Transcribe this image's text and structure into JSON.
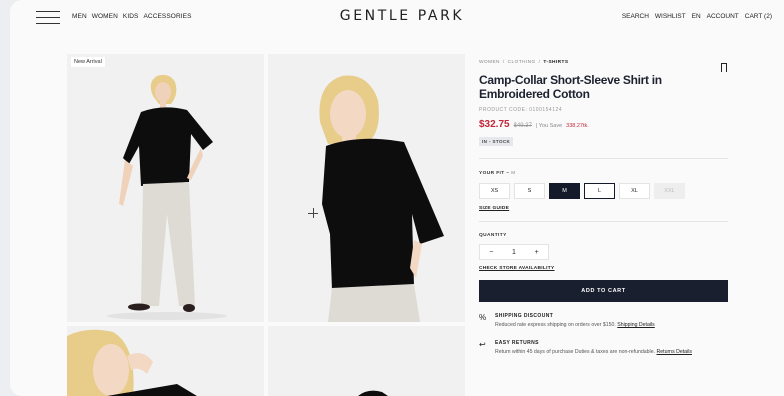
{
  "header": {
    "nav_left": [
      "MEN",
      "WOMEN",
      "KIDS",
      "ACCESSORIES"
    ],
    "logo": "GENTLE PARK",
    "nav_right": [
      "SEARCH",
      "WISHLIST",
      "EN",
      "ACCOUNT",
      "CART (2)"
    ]
  },
  "gallery": {
    "badge": "New Arrival"
  },
  "product": {
    "breadcrumb": [
      "WOMEN",
      "/",
      "CLOTHING",
      "/",
      "T-SHIRTS"
    ],
    "title": "Camp-Collar Short-Sleeve Shirt in Embroidered Cotton",
    "code": "PRODUCT CODE: 0100154124",
    "price": "$32.75",
    "old_price": "$49.37",
    "save_prefix": "| You Save",
    "save_amount": "338.27tk.",
    "stock": "IN - STOCK",
    "fit_label": "YOUR FIT –",
    "fit_value": "M",
    "sizes": [
      "XS",
      "S",
      "M",
      "L",
      "XL",
      "XXL"
    ],
    "size_guide": "SIZE GUIDE",
    "quantity_label": "QUANTITY",
    "qty_minus": "−",
    "qty_value": "1",
    "qty_plus": "+",
    "store_link": "CHECK STORE AVAILABILITY",
    "add_to_cart": "ADD TO CART"
  },
  "info": [
    {
      "icon": "%",
      "title": "SHIPPING DISCOUNT",
      "text": "Reduced rate express shipping on orders over $150.",
      "link": "Shipping Details"
    },
    {
      "icon": "↩",
      "title": "EASY RETURNS",
      "text": "Return within 45 days of purchase Duties & taxes are non-refundable.",
      "link": "Returns Details"
    }
  ],
  "colors": {
    "accent_red": "#c2273a",
    "button_dark": "#1a1f30"
  }
}
